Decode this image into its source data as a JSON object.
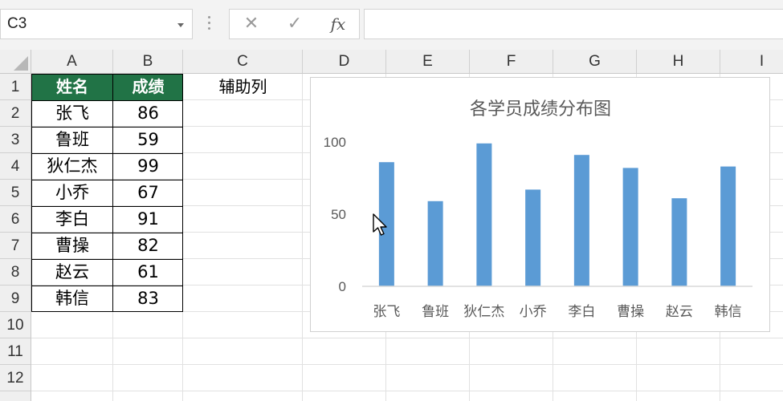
{
  "formula_bar": {
    "name_box": "C3",
    "cancel_glyph": "✕",
    "enter_glyph": "✓",
    "fx_label": "fx",
    "formula": ""
  },
  "columns": [
    "A",
    "B",
    "C",
    "D",
    "E",
    "F",
    "G",
    "H",
    "I"
  ],
  "rows": [
    "1",
    "2",
    "3",
    "4",
    "5",
    "6",
    "7",
    "8",
    "9",
    "10",
    "11",
    "12"
  ],
  "table": {
    "headers": [
      "姓名",
      "成绩"
    ],
    "aux_header": "辅助列",
    "rows": [
      [
        "张飞",
        "86"
      ],
      [
        "鲁班",
        "59"
      ],
      [
        "狄仁杰",
        "99"
      ],
      [
        "小乔",
        "67"
      ],
      [
        "李白",
        "91"
      ],
      [
        "曹操",
        "82"
      ],
      [
        "赵云",
        "61"
      ],
      [
        "韩信",
        "83"
      ]
    ]
  },
  "colors": {
    "header_fill": "#217346",
    "bar": "#5b9bd5",
    "grid": "#e1e1e1"
  },
  "chart_data": {
    "type": "bar",
    "title": "各学员成绩分布图",
    "categories": [
      "张飞",
      "鲁班",
      "狄仁杰",
      "小乔",
      "李白",
      "曹操",
      "赵云",
      "韩信"
    ],
    "values": [
      86,
      59,
      99,
      67,
      91,
      82,
      61,
      83
    ],
    "ylim": [
      0,
      100
    ],
    "yticks": [
      "0",
      "50",
      "100"
    ],
    "grid": false,
    "legend": "none"
  }
}
